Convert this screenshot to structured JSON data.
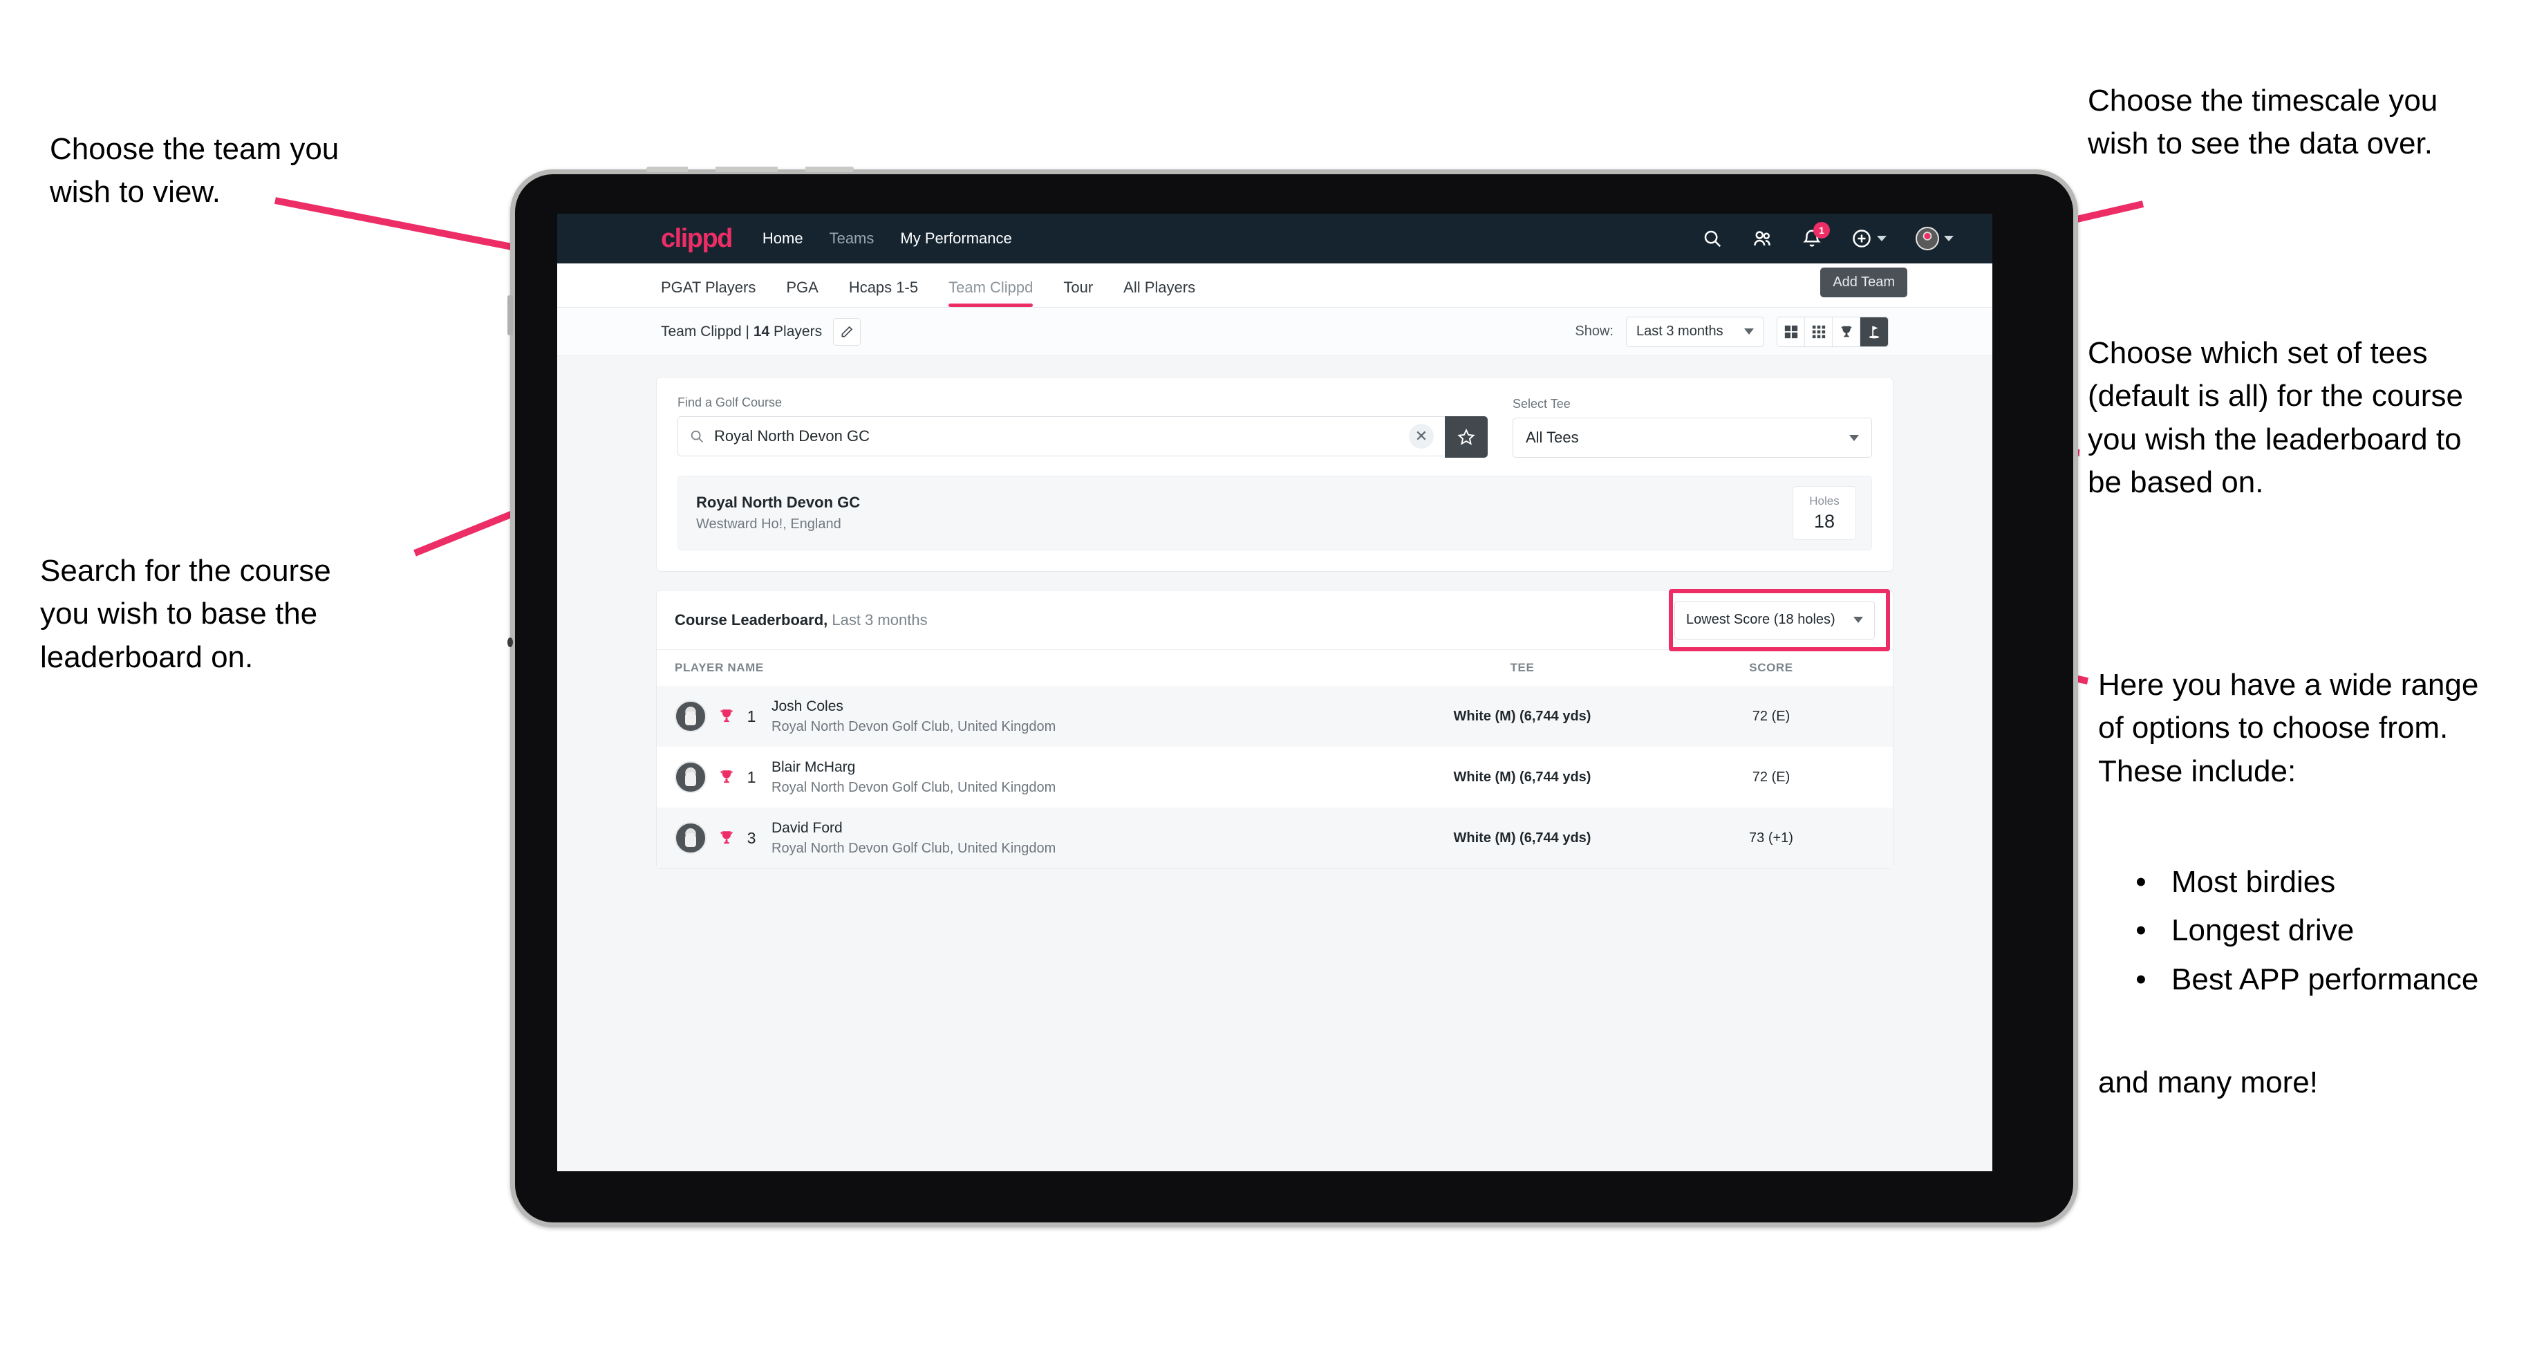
{
  "annotations": {
    "top_left": "Choose the team you\nwish to view.",
    "mid_left": "Search for the course\nyou wish to base the\nleaderboard on.",
    "top_right": "Choose the timescale you\nwish to see the data over.",
    "mid_right": "Choose which set of tees\n(default is all) for the course\nyou wish the leaderboard to\nbe based on.",
    "bottom_right_intro": "Here you have a wide range\nof options to choose from.\nThese include:",
    "bottom_right_bullets": [
      "Most birdies",
      "Longest drive",
      "Best APP performance"
    ],
    "bottom_right_outro": "and many more!"
  },
  "app": {
    "topnav": {
      "brand": "clippd",
      "links": [
        {
          "label": "Home",
          "active": true
        },
        {
          "label": "Teams",
          "active": false
        },
        {
          "label": "My Performance",
          "active": true
        }
      ],
      "icons": {
        "search": "search-icon",
        "people": "people-icon",
        "bell": "bell-icon",
        "bell_badge": "1",
        "plus": "plus-circle-icon",
        "avatar": "user-avatar"
      }
    },
    "tabs": [
      {
        "label": "PGAT Players",
        "active": false
      },
      {
        "label": "PGA",
        "active": false
      },
      {
        "label": "Hcaps 1-5",
        "active": false
      },
      {
        "label": "Team Clippd",
        "active": true
      },
      {
        "label": "Tour",
        "active": false
      },
      {
        "label": "All Players",
        "active": false
      }
    ],
    "tooltip": "Add Team",
    "subbar": {
      "team_prefix": "Team Clippd | ",
      "team_count": "14",
      "team_suffix": " Players",
      "edit_icon": "pencil-icon",
      "show_label": "Show:",
      "timescale_value": "Last 3 months",
      "view_toggles": [
        {
          "icon": "grid-2x2-icon",
          "active": false
        },
        {
          "icon": "grid-3x3-icon",
          "active": false
        },
        {
          "icon": "trophy-icon",
          "active": false
        },
        {
          "icon": "golf-flag-icon",
          "active": true
        }
      ]
    },
    "search_card": {
      "course_label": "Find a Golf Course",
      "course_value": "Royal North Devon GC",
      "course_placeholder": "Find a Golf Course",
      "clear_icon": "close-icon",
      "favourite_icon": "star-icon",
      "tee_label": "Select Tee",
      "tee_value": "All Tees"
    },
    "course_result": {
      "name": "Royal North Devon GC",
      "location": "Westward Ho!, England",
      "holes_label": "Holes",
      "holes_value": "18"
    },
    "leaderboard": {
      "title": "Course Leaderboard,",
      "subtitle": " Last 3 months",
      "sort_value": "Lowest Score (18 holes)",
      "columns": [
        "PLAYER NAME",
        "TEE",
        "SCORE"
      ],
      "rows": [
        {
          "rank": "1",
          "name": "Josh Coles",
          "club": "Royal North Devon Golf Club, United Kingdom",
          "tee": "White (M) (6,744 yds)",
          "score": "72 (E)"
        },
        {
          "rank": "1",
          "name": "Blair McHarg",
          "club": "Royal North Devon Golf Club, United Kingdom",
          "tee": "White (M) (6,744 yds)",
          "score": "72 (E)"
        },
        {
          "rank": "3",
          "name": "David Ford",
          "club": "Royal North Devon Golf Club, United Kingdom",
          "tee": "White (M) (6,744 yds)",
          "score": "73 (+1)"
        }
      ]
    }
  },
  "colors": {
    "accent": "#ec2d66",
    "navbar": "#15242f",
    "dark": "#41484e"
  }
}
